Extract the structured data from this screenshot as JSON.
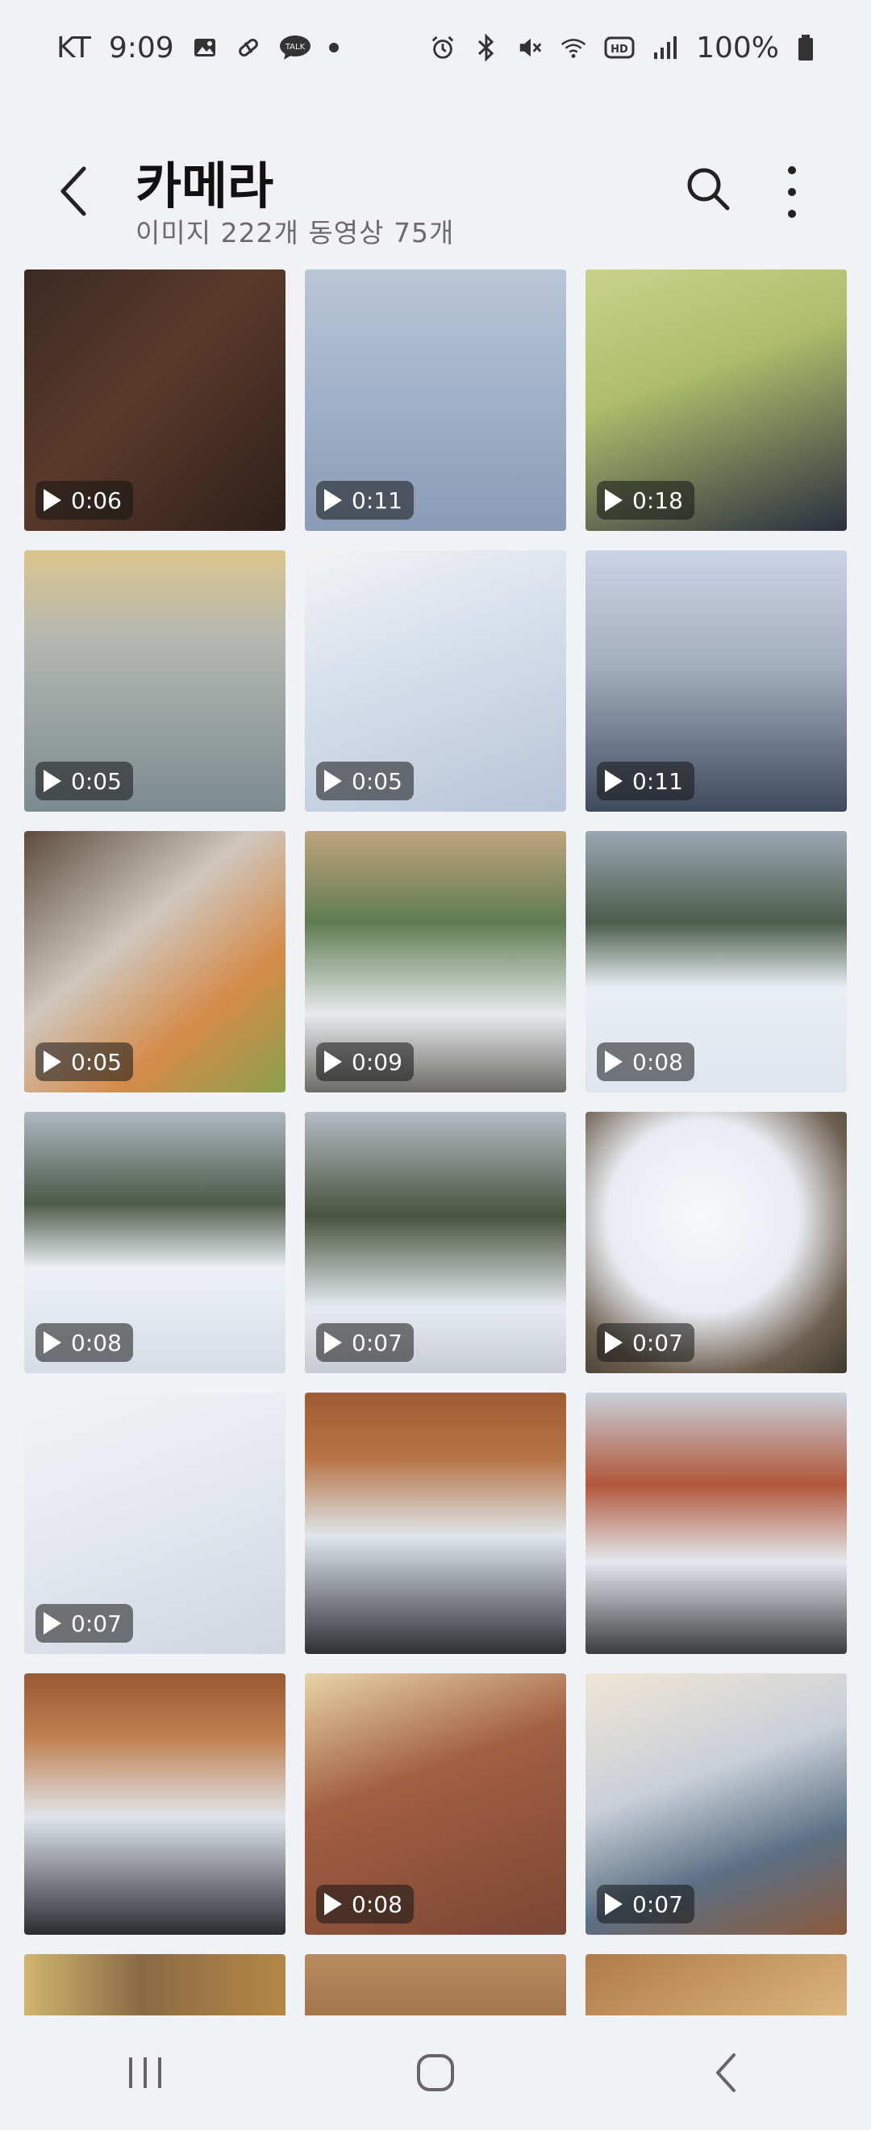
{
  "status_bar": {
    "carrier": "KT",
    "time": "9:09",
    "battery": "100%",
    "left_icons": [
      "image-icon",
      "pill-icon",
      "talk-icon"
    ],
    "right_icons": [
      "alarm-icon",
      "bluetooth-icon",
      "mute-icon",
      "wifi-icon",
      "hd-icon",
      "signal-icon",
      "battery-icon"
    ],
    "talk_badge": "TALK",
    "hd_badge": "HD"
  },
  "header": {
    "title": "카메라",
    "subtitle": "이미지 222개 동영상 75개",
    "back_icon": "back-arrow-icon",
    "search_icon": "search-icon",
    "more_icon": "more-vertical-icon"
  },
  "thumbnails": [
    {
      "duration": "0:06",
      "is_video": true
    },
    {
      "duration": "0:11",
      "is_video": true
    },
    {
      "duration": "0:18",
      "is_video": true
    },
    {
      "duration": "0:05",
      "is_video": true
    },
    {
      "duration": "0:05",
      "is_video": true
    },
    {
      "duration": "0:11",
      "is_video": true
    },
    {
      "duration": "0:05",
      "is_video": true
    },
    {
      "duration": "0:09",
      "is_video": true
    },
    {
      "duration": "0:08",
      "is_video": true
    },
    {
      "duration": "0:08",
      "is_video": true
    },
    {
      "duration": "0:07",
      "is_video": true
    },
    {
      "duration": "0:07",
      "is_video": true
    },
    {
      "duration": "0:07",
      "is_video": true
    },
    {
      "duration": "",
      "is_video": false
    },
    {
      "duration": "",
      "is_video": false
    },
    {
      "duration": "",
      "is_video": false
    },
    {
      "duration": "0:08",
      "is_video": true
    },
    {
      "duration": "0:07",
      "is_video": true
    },
    {
      "duration": "",
      "is_video": false
    },
    {
      "duration": "",
      "is_video": false
    },
    {
      "duration": "",
      "is_video": false
    }
  ],
  "navbar": {
    "recents_icon": "recents-icon",
    "home_icon": "home-icon",
    "back_icon": "nav-back-icon"
  }
}
